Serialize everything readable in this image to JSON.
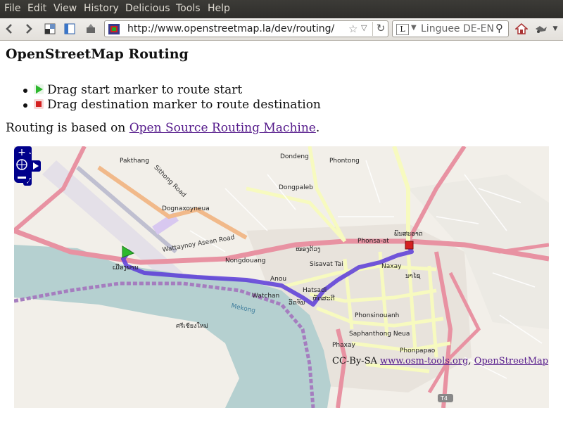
{
  "menu": [
    "File",
    "Edit",
    "View",
    "History",
    "Delicious",
    "Tools",
    "Help"
  ],
  "toolbar": {
    "url": "http://www.openstreetmap.la/dev/routing/",
    "search_engine_placeholder": "Linguee DE-EN",
    "search_engine_letter": "L"
  },
  "page": {
    "title": "OpenStreetMap Routing",
    "instructions": [
      "Drag start marker to route start",
      "Drag destination marker to route destination"
    ],
    "routing_prefix": "Routing is based on ",
    "routing_link": "Open Source Routing Machine",
    "routing_suffix": "."
  },
  "map": {
    "labels": {
      "pakthang": "Pakthang",
      "dondeng": "Dondeng",
      "phontong": "Phontong",
      "dongpaleb": "Dongpaleb",
      "dognaxoyneua": "Dognaxoyneua",
      "wattaynoy": "Wattaynoy Asean Road",
      "sithong": "Sithong Road",
      "nongdouang": "Nongdouang",
      "phonsa_at": "Phonsa-at",
      "naxay": "Naxay",
      "sisavat": "Sisavat Tai",
      "anou": "Anou",
      "watchan": "Watchan",
      "hatsadi": "Hatsadi",
      "mekong": "Mekong",
      "phonsinouanh": "Phonsinouanh",
      "saphanthong": "Saphanthong Neua",
      "phaxay": "Phaxay",
      "phonpapao": "Phonpapao",
      "t4": "T4",
      "thai_script": "ศรีเชียงใหม่",
      "lao_1": "ເມືອງພານ",
      "lao_2": "ໜອງດ້ວງ",
      "lao_3": "ວັດຈັນ",
      "lao_4": "ຫັດສະດີ",
      "lao_5": "ນາໄຊ",
      "lao_6": "ພົນສະອາດ"
    },
    "attribution_prefix": "CC-By-SA ",
    "attribution_link1": "www.osm-tools.org",
    "attribution_sep": ", ",
    "attribution_link2": "OpenStreetMap"
  },
  "colors": {
    "route": "#5b3bd8",
    "river": "#b5d0d0",
    "major_road": "#e892a2",
    "secondary_road": "#f7fabf",
    "start_marker": "#2db82d",
    "dest_marker": "#d42020"
  }
}
